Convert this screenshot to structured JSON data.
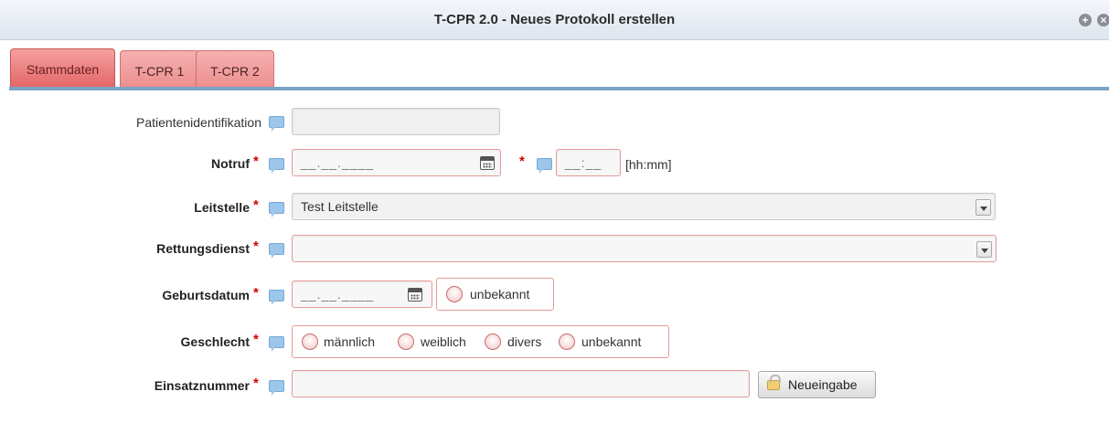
{
  "window": {
    "title": "T-CPR 2.0 - Neues Protokoll erstellen",
    "buttons": [
      "plus-circle-icon",
      "close-circle-icon"
    ]
  },
  "tabs": [
    {
      "label": "Stammdaten",
      "active": true
    },
    {
      "label": "T-CPR 1",
      "active": false
    },
    {
      "label": "T-CPR 2",
      "active": false
    }
  ],
  "form": {
    "patient_id": {
      "label": "Patientenidentifikation",
      "value": ""
    },
    "notruf": {
      "label": "Notruf",
      "required": "*",
      "date_mask": "__.__.____",
      "time_mask": "__:__",
      "time_unit": "[hh:mm]"
    },
    "leitstelle": {
      "label": "Leitstelle",
      "required": "*",
      "value": "Test Leitstelle"
    },
    "rettungsdienst": {
      "label": "Rettungsdienst",
      "required": "*",
      "value": ""
    },
    "geburtsdatum": {
      "label": "Geburtsdatum",
      "required": "*",
      "date_mask": "__.__.____",
      "unknown_label": "unbekannt"
    },
    "geschlecht": {
      "label": "Geschlecht",
      "required": "*",
      "options": [
        "männlich",
        "weiblich",
        "divers",
        "unbekannt"
      ]
    },
    "einsatznummer": {
      "label": "Einsatznummer",
      "required": "*",
      "value": "",
      "button_label": "Neueingabe"
    }
  },
  "colors": {
    "tab_active": "#e26868",
    "tab": "#ec8f8f",
    "required": "#d40000",
    "field_border": "#e79a9a",
    "note_icon": "#9cc6ea"
  }
}
